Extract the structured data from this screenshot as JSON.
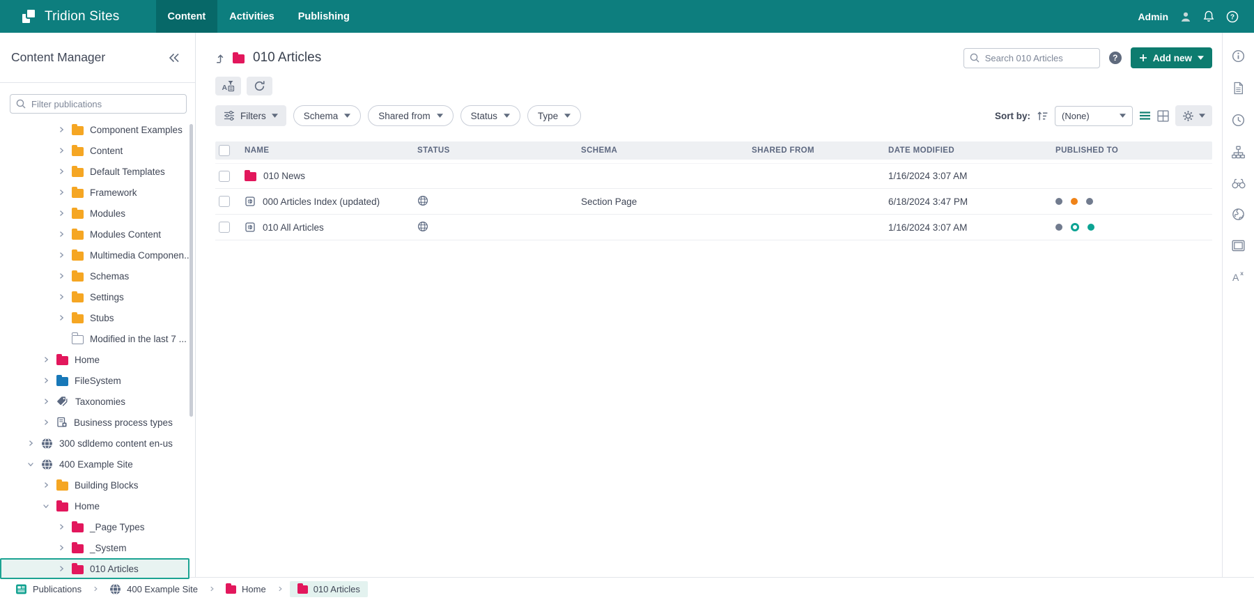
{
  "topbar": {
    "brand": "Tridion Sites",
    "tabs": [
      {
        "label": "Content",
        "active": true
      },
      {
        "label": "Activities",
        "active": false
      },
      {
        "label": "Publishing",
        "active": false
      }
    ],
    "user": "Admin"
  },
  "sidebar": {
    "title": "Content Manager",
    "filter_placeholder": "Filter publications",
    "tree": [
      {
        "label": "Component Examples",
        "icon": "folder-orange",
        "level": 3,
        "chevron": "right",
        "selected": false
      },
      {
        "label": "Content",
        "icon": "folder-orange",
        "level": 3,
        "chevron": "right",
        "selected": false
      },
      {
        "label": "Default Templates",
        "icon": "folder-orange",
        "level": 3,
        "chevron": "right",
        "selected": false
      },
      {
        "label": "Framework",
        "icon": "folder-orange",
        "level": 3,
        "chevron": "right",
        "selected": false
      },
      {
        "label": "Modules",
        "icon": "folder-orange",
        "level": 3,
        "chevron": "right",
        "selected": false
      },
      {
        "label": "Modules Content",
        "icon": "folder-orange",
        "level": 3,
        "chevron": "right",
        "selected": false
      },
      {
        "label": "Multimedia Componen...",
        "icon": "folder-orange",
        "level": 3,
        "chevron": "right",
        "selected": false
      },
      {
        "label": "Schemas",
        "icon": "folder-orange",
        "level": 3,
        "chevron": "right",
        "selected": false
      },
      {
        "label": "Settings",
        "icon": "folder-orange",
        "level": 3,
        "chevron": "right",
        "selected": false
      },
      {
        "label": "Stubs",
        "icon": "folder-orange",
        "level": 3,
        "chevron": "right",
        "selected": false
      },
      {
        "label": "Modified in the last 7 ...",
        "icon": "folder-outline",
        "level": 3,
        "chevron": "none",
        "selected": false
      },
      {
        "label": "Home",
        "icon": "folder-pink",
        "level": 2,
        "chevron": "right",
        "selected": false
      },
      {
        "label": "FileSystem",
        "icon": "folder-blue",
        "level": 2,
        "chevron": "right",
        "selected": false
      },
      {
        "label": "Taxonomies",
        "icon": "tags",
        "level": 2,
        "chevron": "right",
        "selected": false
      },
      {
        "label": "Business process types",
        "icon": "process",
        "level": 2,
        "chevron": "right",
        "selected": false
      },
      {
        "label": "300 sdldemo content en-us",
        "icon": "globe",
        "level": 1,
        "chevron": "right",
        "selected": false
      },
      {
        "label": "400 Example Site",
        "icon": "globe",
        "level": 1,
        "chevron": "down",
        "selected": false
      },
      {
        "label": "Building Blocks",
        "icon": "folder-orange",
        "level": 2,
        "chevron": "right",
        "selected": false
      },
      {
        "label": "Home",
        "icon": "folder-pink",
        "level": 2,
        "chevron": "down",
        "selected": false
      },
      {
        "label": "_Page Types",
        "icon": "folder-pink",
        "level": 3,
        "chevron": "right",
        "selected": false
      },
      {
        "label": "_System",
        "icon": "folder-pink",
        "level": 3,
        "chevron": "right",
        "selected": false
      },
      {
        "label": "010 Articles",
        "icon": "folder-pink",
        "level": 3,
        "chevron": "right",
        "selected": true
      }
    ]
  },
  "main": {
    "title": "010 Articles",
    "search_placeholder": "Search 010 Articles",
    "add_new_label": "Add new",
    "filters": {
      "filters_label": "Filters",
      "pills": [
        "Schema",
        "Shared from",
        "Status",
        "Type"
      ]
    },
    "sort": {
      "label": "Sort by:",
      "value": "(None)"
    },
    "table": {
      "columns": [
        "NAME",
        "STATUS",
        "SCHEMA",
        "SHARED FROM",
        "DATE MODIFIED",
        "PUBLISHED TO"
      ],
      "rows": [
        {
          "name": "010 News",
          "type": "folder",
          "status": "",
          "schema": "",
          "shared_from": "",
          "date_modified": "1/16/2024 3:07 AM",
          "published_to": []
        },
        {
          "name": "000 Articles Index (updated)",
          "type": "page",
          "status": "published",
          "schema": "Section Page",
          "shared_from": "",
          "date_modified": "6/18/2024 3:47 PM",
          "published_to": [
            "gray",
            "orange",
            "gray"
          ]
        },
        {
          "name": "010 All Articles",
          "type": "page",
          "status": "published",
          "schema": "",
          "shared_from": "",
          "date_modified": "1/16/2024 3:07 AM",
          "published_to": [
            "gray",
            "teal-ring",
            "teal"
          ]
        }
      ]
    }
  },
  "rail_icons": [
    "info",
    "document",
    "clock",
    "sitemap",
    "binoculars",
    "globe-rail",
    "monitor",
    "translate"
  ],
  "breadcrumb": [
    {
      "label": "Publications",
      "icon": "publications",
      "active": false
    },
    {
      "label": "400 Example Site",
      "icon": "globe",
      "active": false
    },
    {
      "label": "Home",
      "icon": "folder-pink",
      "active": false
    },
    {
      "label": "010 Articles",
      "icon": "folder-pink",
      "active": true
    }
  ],
  "colors": {
    "topbar": "#0D7E7E",
    "topbar_active_tab": "#076868",
    "accent_button": "#0D7C6F",
    "selection": "#1BA392",
    "folder_orange": "#F5A623",
    "folder_pink": "#E2175C",
    "folder_blue": "#1878B8",
    "dot_gray": "#717B8E",
    "dot_orange": "#EF8318",
    "dot_teal": "#0CA393"
  }
}
